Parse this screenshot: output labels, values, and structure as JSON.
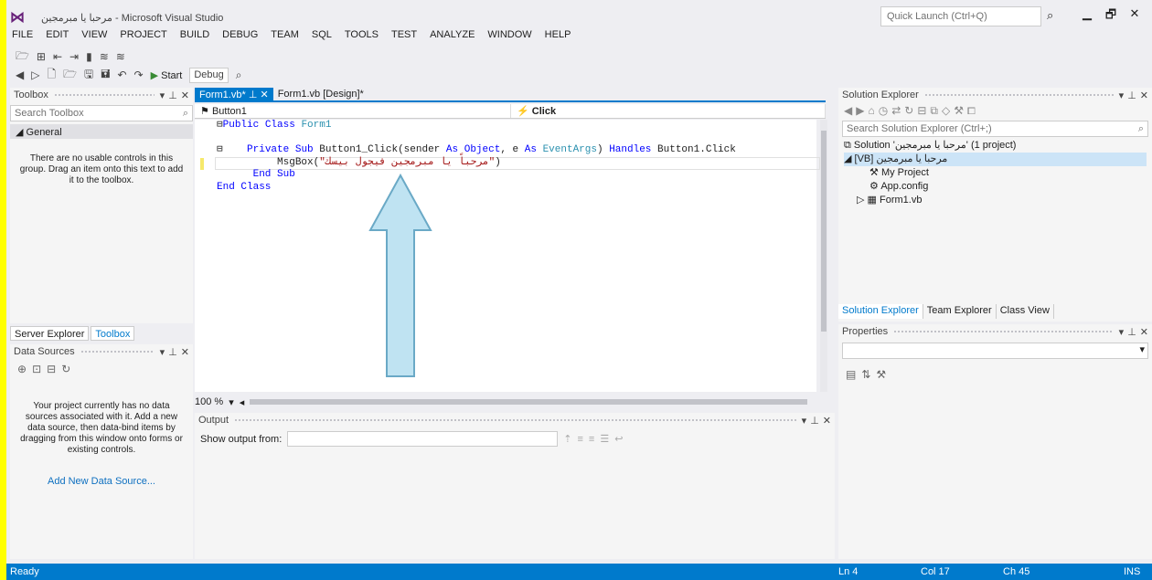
{
  "window": {
    "title": "مرحبا يا مبرمجين - Microsoft Visual Studio",
    "quick_launch_placeholder": "Quick Launch (Ctrl+Q)",
    "min_glyph": "▁",
    "max_glyph": "🗗",
    "close_glyph": "✕"
  },
  "menu": [
    "FILE",
    "EDIT",
    "VIEW",
    "PROJECT",
    "BUILD",
    "DEBUG",
    "TEAM",
    "SQL",
    "TOOLS",
    "TEST",
    "ANALYZE",
    "WINDOW",
    "HELP"
  ],
  "toolbar": {
    "start_label": "Start",
    "config": "Debug"
  },
  "toolbox": {
    "title": "Toolbox",
    "search_placeholder": "Search Toolbox",
    "group": "◢ General",
    "empty_message": "There are no usable controls in this group. Drag an item onto this text to add it to the toolbox."
  },
  "bottom_left_tabs": [
    "Server Explorer",
    "Toolbox"
  ],
  "data_sources": {
    "title": "Data Sources",
    "message": "Your project currently has no data sources associated with it. Add a new data source, then data-bind items by dragging from this window onto forms or existing controls.",
    "link": "Add New Data Source..."
  },
  "doc_tabs": [
    "Form1.vb*",
    "Form1.vb [Design]*"
  ],
  "nav": {
    "left": "Button1",
    "right": "Click"
  },
  "code": {
    "line1": [
      "Public Class",
      "Form1"
    ],
    "line2_kw1": "Private Sub",
    "line2_name": "Button1_Click(sender",
    "line2_as1": "As",
    "line2_t1": "Object",
    "line2_e": ", e",
    "line2_as2": "As",
    "line2_t2": "EventArgs",
    "line2_close": ")",
    "line2_handles": "Handles",
    "line2_target": "Button1.Click",
    "line3_call": "MsgBox(",
    "line3_string": "\"مرحباً يا مبرمجين فيجول بيسك\"",
    "line3_close": ")",
    "line4": "End Sub",
    "line5": "End Class"
  },
  "zoom": "100 %",
  "output": {
    "title": "Output",
    "show_from": "Show output from:"
  },
  "solution_explorer": {
    "title": "Solution Explorer",
    "search_placeholder": "Search Solution Explorer (Ctrl+;)",
    "solution_label": "Solution 'مرحبا يا مبرمجين' (1 project)",
    "project_label": "مرحبا يا مبرمجين",
    "items": [
      "My Project",
      "App.config",
      "Form1.vb"
    ]
  },
  "sol_tabs": [
    "Solution Explorer",
    "Team Explorer",
    "Class View"
  ],
  "properties": {
    "title": "Properties"
  },
  "status": {
    "ready": "Ready",
    "ln": "Ln 4",
    "col": "Col 17",
    "ch": "Ch 45",
    "ins": "INS"
  },
  "colors": {
    "accent": "#007acc",
    "outer_border": "#ffff00",
    "arrow_fill": "#bfe3f2"
  }
}
